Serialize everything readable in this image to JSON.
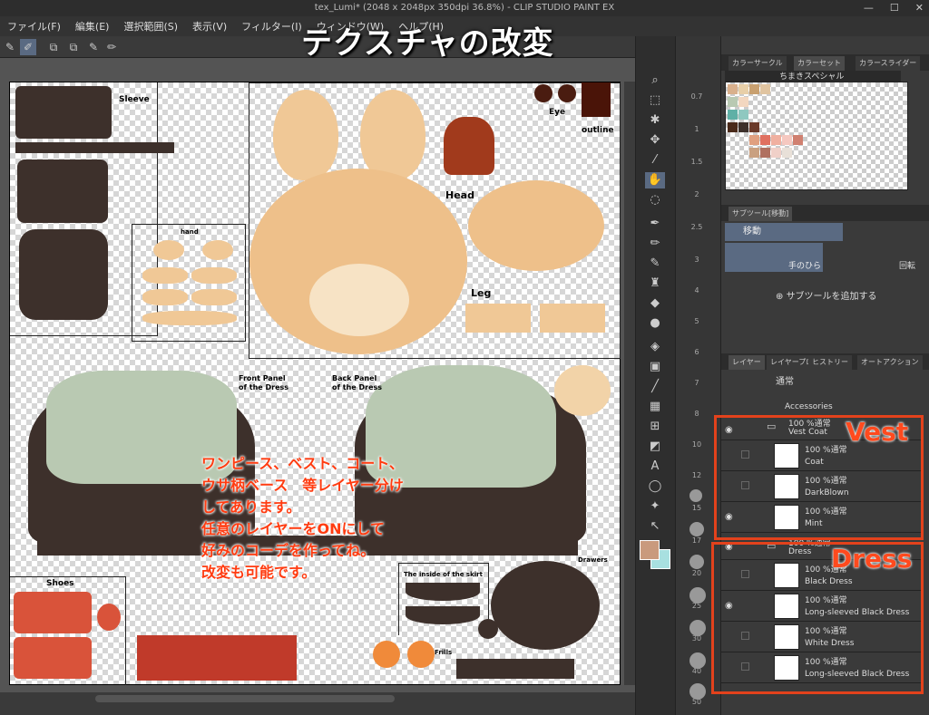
{
  "window": {
    "title": "tex_Lumi* (2048 x 2048px 350dpi 36.8%) - CLIP STUDIO PAINT EX"
  },
  "overlay_title": "テクスチャの改変",
  "menu": [
    "ファイル(F)",
    "編集(E)",
    "選択範囲(S)",
    "表示(V)",
    "フィルター(I)",
    "ウィンドウ(W)",
    "ヘルプ(H)"
  ],
  "canvas_labels": {
    "sleeve": "Sleeve",
    "eye": "Eye",
    "outline": "outline",
    "head": "Head",
    "hand": "hand",
    "leg": "Leg",
    "front_panel": "Front Panel\nof the Dress",
    "back_panel": "Back Panel\nof the Dress",
    "shoes": "Shoes",
    "skirt_inside": "The inside of the skirt",
    "drawers": "Drawers",
    "frills": "Frills"
  },
  "note": [
    "ワンピース、ベスト、コート、",
    "ウサ柄ベース　等レイヤー分け",
    "してあります。",
    "任意のレイヤーをONにして",
    "好みのコーデを作ってね。",
    "改変も可能です。"
  ],
  "brush_sizes": [
    "0.7",
    "1",
    "1.5",
    "2",
    "2.5",
    "3",
    "4",
    "5",
    "6",
    "7",
    "8",
    "10",
    "12",
    "15",
    "17",
    "20",
    "25",
    "30",
    "40",
    "50"
  ],
  "color_panel": {
    "tabs": [
      "カラーサークル",
      "カラーセット",
      "カラースライダー"
    ],
    "set_name": "ちまきスペシャル"
  },
  "subtool_panel": {
    "tab": "サブツール[移動]",
    "group": "移動",
    "tool": "手のひら",
    "rotate": "回転",
    "add": "サブツールを追加する"
  },
  "layer_panel": {
    "tabs": [
      "レイヤー",
      "レイヤープロパティ",
      "ヒストリー",
      "オートアクション"
    ],
    "blend_mode": "通常",
    "top_item": "Accessories",
    "layers": [
      {
        "opacity": "100 %通常",
        "name": "Vest Coat",
        "folder": true,
        "visible": true
      },
      {
        "opacity": "100 %通常",
        "name": "Coat",
        "folder": false,
        "visible": false
      },
      {
        "opacity": "100 %通常",
        "name": "DarkBlown",
        "folder": false,
        "visible": false
      },
      {
        "opacity": "100 %通常",
        "name": "Mint",
        "folder": false,
        "visible": true
      },
      {
        "opacity": "100 %通常",
        "name": "Dress",
        "folder": true,
        "visible": true
      },
      {
        "opacity": "100 %通常",
        "name": "Black Dress",
        "folder": false,
        "visible": false
      },
      {
        "opacity": "100 %通常",
        "name": "Long-sleeved Black Dress",
        "folder": false,
        "visible": true
      },
      {
        "opacity": "100 %通常",
        "name": "White Dress",
        "folder": false,
        "visible": false
      },
      {
        "opacity": "100 %通常",
        "name": "Long-sleeved Black Dress",
        "folder": false,
        "visible": false
      }
    ]
  },
  "annotations": {
    "vest": "Vest",
    "dress": "Dress"
  },
  "colors": {
    "accent_red": "#e3421c",
    "selected": "#5a6a82",
    "main_color": "#c99a7d",
    "sub_color": "#a8e0e0"
  }
}
